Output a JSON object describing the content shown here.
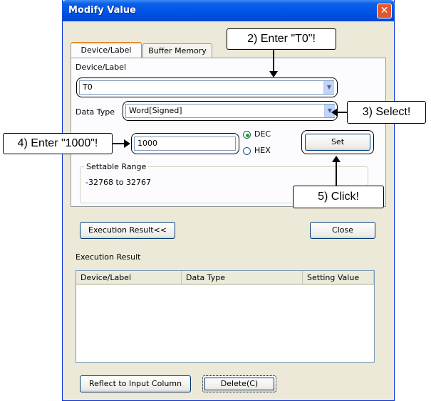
{
  "window": {
    "title": "Modify Value",
    "close_label": "✕"
  },
  "tabs": [
    {
      "label": "Device/Label",
      "active": true
    },
    {
      "label": "Buffer Memory",
      "active": false
    }
  ],
  "device_label": {
    "label": "Device/Label",
    "value": "T0"
  },
  "data_type": {
    "label": "Data Type",
    "value": "Word[Signed]"
  },
  "value_input": {
    "value": "1000"
  },
  "radix": {
    "dec_label": "DEC",
    "hex_label": "HEX",
    "selected": "DEC"
  },
  "set_button": {
    "label": "Set"
  },
  "settable_range": {
    "title": "Settable Range",
    "value": "-32768 to 32767"
  },
  "execution_result_toggle": {
    "label": "Execution Result<<"
  },
  "close_button": {
    "label": "Close"
  },
  "execution_result": {
    "title": "Execution Result",
    "columns": [
      "Device/Label",
      "Data Type",
      "Setting Value"
    ],
    "rows": []
  },
  "reflect_button": {
    "label": "Reflect to Input Column"
  },
  "delete_button": {
    "label": "Delete(C)"
  },
  "annotations": {
    "step2": "2) Enter \"T0\"!",
    "step3": "3) Select!",
    "step4": "4) Enter \"1000\"!",
    "step5": "5) Click!"
  }
}
